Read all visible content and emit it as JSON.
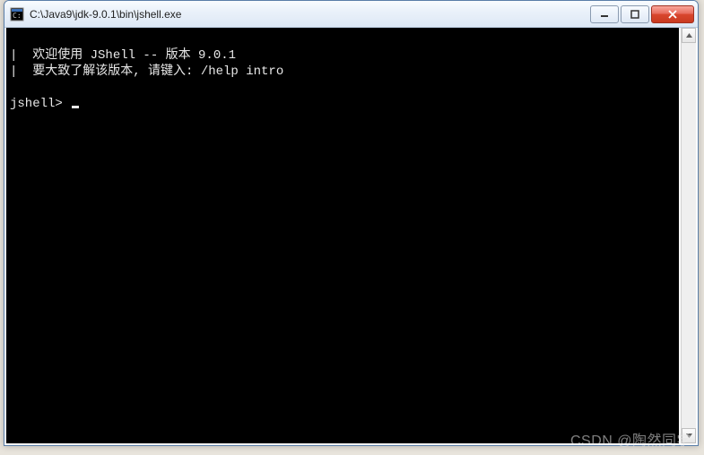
{
  "window": {
    "title": "C:\\Java9\\jdk-9.0.1\\bin\\jshell.exe"
  },
  "terminal": {
    "line1_prefix": "|  ",
    "line1_text": "欢迎使用 JShell -- 版本 9.0.1",
    "line2_prefix": "|  ",
    "line2_text": "要大致了解该版本, 请键入: /help intro",
    "blank": "",
    "prompt": "jshell> "
  },
  "watermark": "CSDN @陶然同学"
}
